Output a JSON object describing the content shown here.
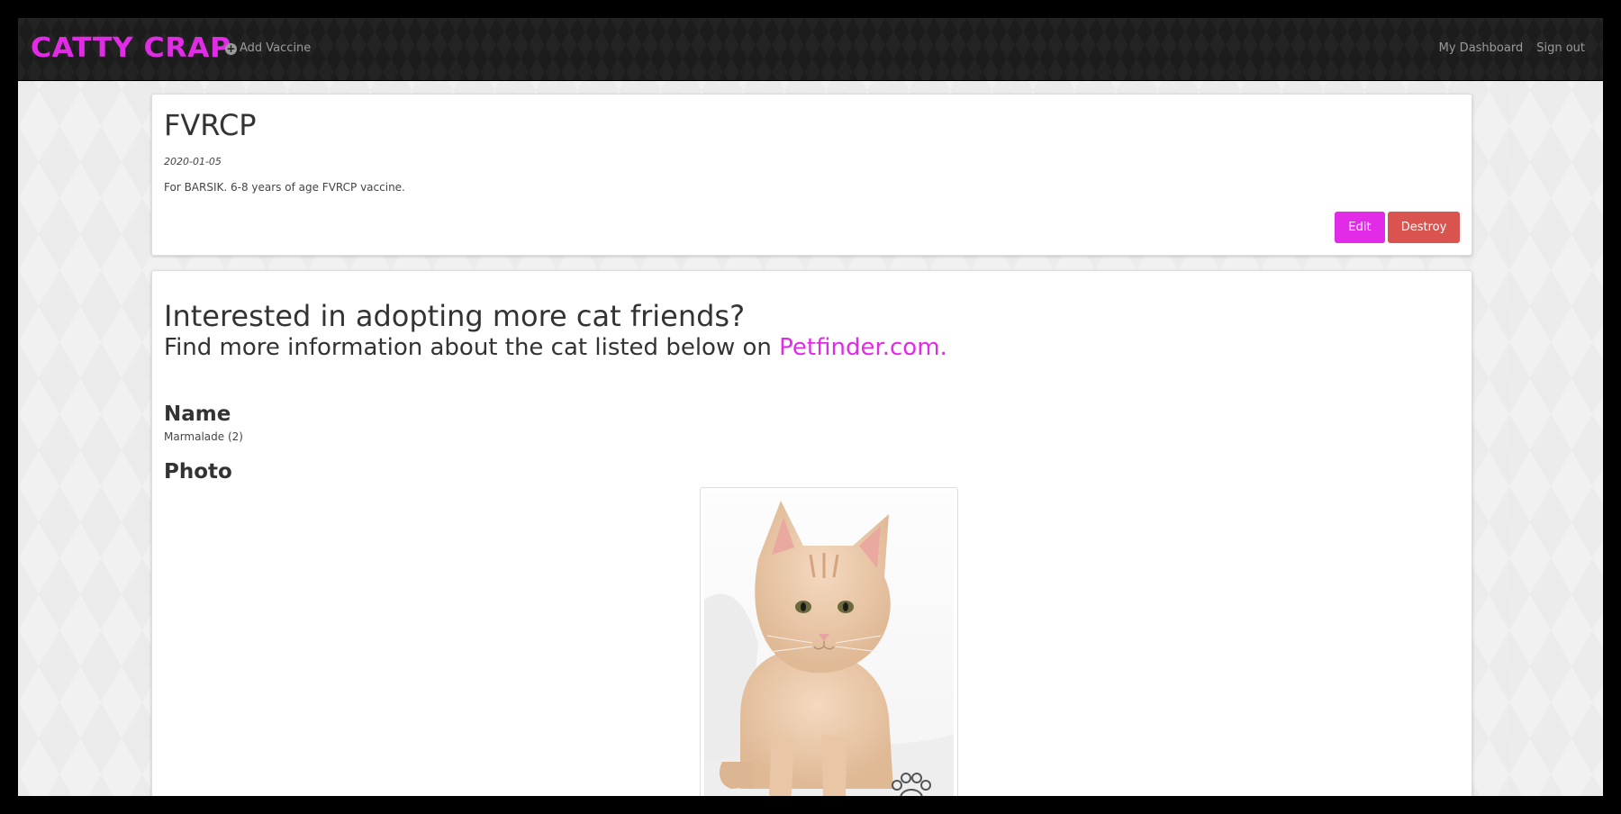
{
  "navbar": {
    "brand": "CATTY CRAP",
    "add_vaccine": "Add Vaccine",
    "dashboard": "My Dashboard",
    "sign_out": "Sign out"
  },
  "vaccine": {
    "title": "FVRCP",
    "date": "2020-01-05",
    "description": "For BARSIK. 6-8 years of age FVRCP vaccine.",
    "edit_label": "Edit",
    "destroy_label": "Destroy"
  },
  "adoption": {
    "heading": "Interested in adopting more cat friends?",
    "subheading": "Find more information about the cat listed below on",
    "link_text": "Petfinder.com.",
    "name_label": "Name",
    "name_value": "Marmalade (2)",
    "photo_label": "Photo"
  },
  "colors": {
    "brand": "#e22be6",
    "destroy": "#d9534f",
    "navbar": "#1c1c1c"
  },
  "icons": {
    "add_vaccine": "plus-circle-icon",
    "photo_watermark": "paw-icon"
  }
}
